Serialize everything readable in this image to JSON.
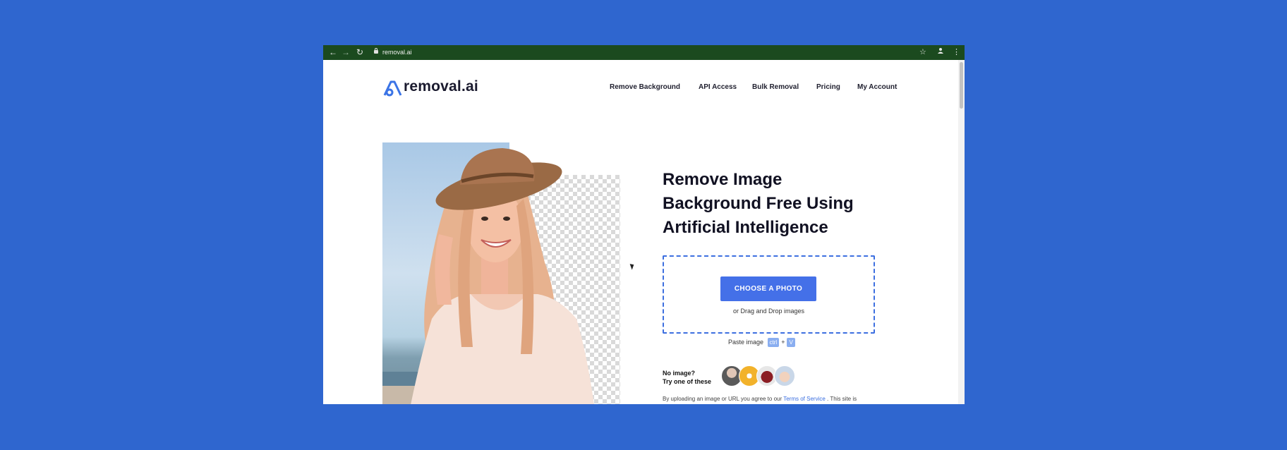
{
  "browser": {
    "url": "removal.ai",
    "icons": [
      "back-arrow-icon",
      "forward-arrow-icon",
      "reload-icon",
      "lock-icon",
      "star-icon",
      "profile-icon",
      "kebab-menu-icon"
    ]
  },
  "header": {
    "logo_text": "removal.ai",
    "nav": [
      "Remove Background",
      "API Access",
      "Bulk Removal",
      "Pricing",
      "My Account"
    ]
  },
  "hero": {
    "headline_line1": "Remove Image",
    "headline_line2": "Background Free Using",
    "headline_line3": "Artificial Intelligence"
  },
  "upload": {
    "button_label": "CHOOSE A PHOTO",
    "drag_text": "or Drag and Drop images",
    "paste_label": "Paste image",
    "key_ctrl": "ctrl",
    "key_plus": "+",
    "key_v": "V"
  },
  "samples": {
    "label_line1": "No image?",
    "label_line2": "Try one of these"
  },
  "terms": {
    "prefix": "By uploading an image or URL you agree to our",
    "link": "Terms of Service",
    "suffix": ". This site is"
  },
  "colors": {
    "page_bg": "#2f66cf",
    "accent": "#4470e8",
    "browser_bar": "#1b4a1f"
  }
}
